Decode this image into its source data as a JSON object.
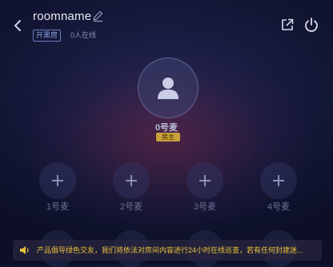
{
  "header": {
    "room_name": "roomname",
    "mode_tag": "开黑房",
    "online_count": "0人在线"
  },
  "icons": {
    "back": "chevron-left-icon",
    "edit": "pencil-icon",
    "share": "share-external-icon",
    "power": "power-icon",
    "speaker": "speaker-icon"
  },
  "host": {
    "label": "0号麦",
    "badge": "房主"
  },
  "seats": [
    {
      "label": "1号麦"
    },
    {
      "label": "2号麦"
    },
    {
      "label": "3号麦"
    },
    {
      "label": "4号麦"
    }
  ],
  "notice": {
    "text": "产品倡导绿色交友，我们将依法对房间内容进行24小时在线巡查，若有任何封建迷..."
  },
  "colors": {
    "accent_badge": "#c8a23a",
    "notice_text": "#e9c23a",
    "tag_border": "#6b7fc4"
  }
}
